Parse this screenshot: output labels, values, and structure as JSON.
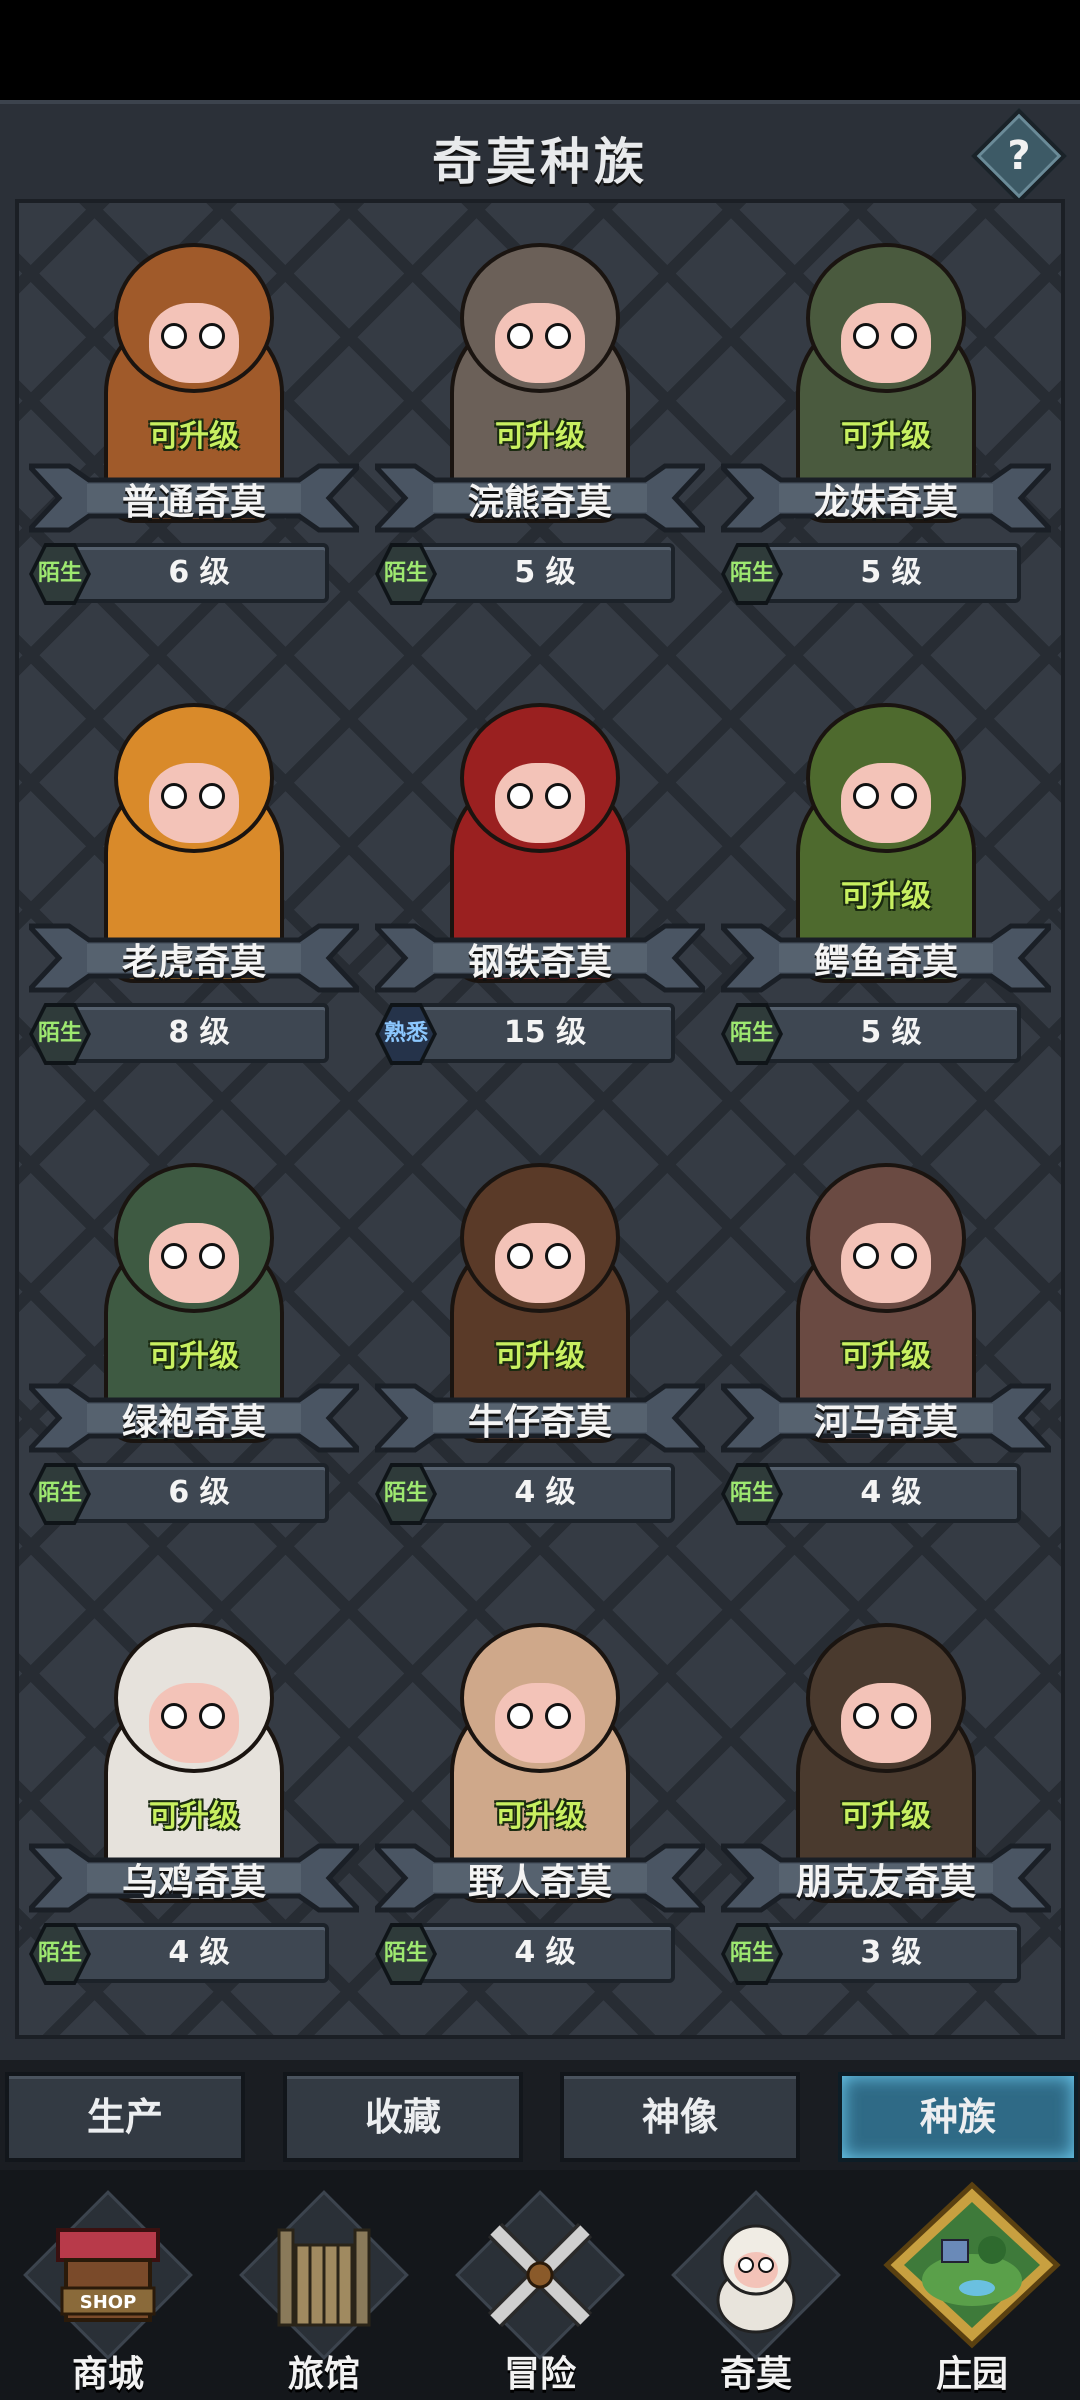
{
  "header": {
    "title": "奇莫种族",
    "help_label": "?"
  },
  "creatures": [
    {
      "name": "普通奇莫",
      "level": "6 级",
      "familiarity": "陌生",
      "upgrade": "可升级",
      "color": "#a05a2a"
    },
    {
      "name": "浣熊奇莫",
      "level": "5 级",
      "familiarity": "陌生",
      "upgrade": "可升级",
      "color": "#6b6058"
    },
    {
      "name": "龙妹奇莫",
      "level": "5 级",
      "familiarity": "陌生",
      "upgrade": "可升级",
      "color": "#4a5a3e"
    },
    {
      "name": "老虎奇莫",
      "level": "8 级",
      "familiarity": "陌生",
      "upgrade": "",
      "color": "#d98a2a"
    },
    {
      "name": "钢铁奇莫",
      "level": "15 级",
      "familiarity": "熟悉",
      "upgrade": "",
      "color": "#9a2020"
    },
    {
      "name": "鳄鱼奇莫",
      "level": "5 级",
      "familiarity": "陌生",
      "upgrade": "可升级",
      "color": "#4e6a2e"
    },
    {
      "name": "绿袍奇莫",
      "level": "6 级",
      "familiarity": "陌生",
      "upgrade": "可升级",
      "color": "#3e5a42"
    },
    {
      "name": "牛仔奇莫",
      "level": "4 级",
      "familiarity": "陌生",
      "upgrade": "可升级",
      "color": "#5a3a28"
    },
    {
      "name": "河马奇莫",
      "level": "4 级",
      "familiarity": "陌生",
      "upgrade": "可升级",
      "color": "#6a4a42"
    },
    {
      "name": "乌鸡奇莫",
      "level": "4 级",
      "familiarity": "陌生",
      "upgrade": "可升级",
      "color": "#e6e2dc"
    },
    {
      "name": "野人奇莫",
      "level": "4 级",
      "familiarity": "陌生",
      "upgrade": "可升级",
      "color": "#cfa88a"
    },
    {
      "name": "朋克友奇莫",
      "level": "3 级",
      "familiarity": "陌生",
      "upgrade": "可升级",
      "color": "#4a3a2e"
    }
  ],
  "tabs": [
    {
      "label": "生产",
      "active": false
    },
    {
      "label": "收藏",
      "active": false
    },
    {
      "label": "神像",
      "active": false
    },
    {
      "label": "种族",
      "active": true
    }
  ],
  "bottom_nav": [
    {
      "label": "商城",
      "icon": "shop-icon",
      "sign": "SHOP"
    },
    {
      "label": "旅馆",
      "icon": "inn-gate-icon"
    },
    {
      "label": "冒险",
      "icon": "crossed-swords-icon"
    },
    {
      "label": "奇莫",
      "icon": "qimo-character-icon"
    },
    {
      "label": "庄园",
      "icon": "manor-island-icon"
    }
  ],
  "colors": {
    "upgrade_text": "#c8f060",
    "active_tab": "#2f6a86",
    "panel_bg": "#2b3038"
  }
}
